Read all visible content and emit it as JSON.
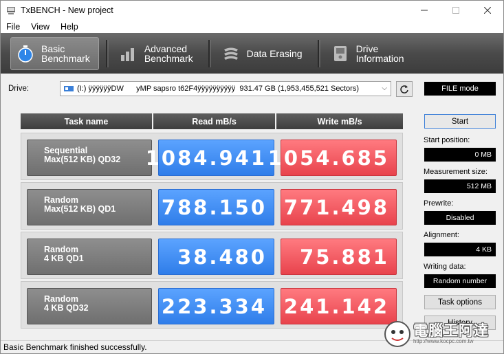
{
  "window": {
    "title": "TxBENCH - New project"
  },
  "menu": {
    "items": [
      "File",
      "View",
      "Help"
    ]
  },
  "toolbar": {
    "tabs": [
      {
        "label": "Basic\nBenchmark",
        "icon": "stopwatch-icon",
        "active": true
      },
      {
        "label": "Advanced\nBenchmark",
        "icon": "bar-chart-icon",
        "active": false
      },
      {
        "label": "Data Erasing",
        "icon": "eraser-icon",
        "active": false
      },
      {
        "label": "Drive\nInformation",
        "icon": "drive-info-icon",
        "active": false
      }
    ]
  },
  "drive": {
    "label": "Drive:",
    "selected": "(I:) ÿÿÿÿÿÿDW      yMP sapsro t62F4ÿÿÿÿÿÿÿÿÿÿ  931.47 GB (1,953,455,521 Sectors)",
    "mode": "FILE mode"
  },
  "table": {
    "headers": [
      "Task name",
      "Read mB/s",
      "Write mB/s"
    ],
    "rows": [
      {
        "task_line1": "Sequential",
        "task_line2": "Max(512 KB) QD32",
        "read": "1084.941",
        "write": "1054.685"
      },
      {
        "task_line1": "Random",
        "task_line2": "Max(512 KB) QD1",
        "read": "788.150",
        "write": "771.498"
      },
      {
        "task_line1": "Random",
        "task_line2": "4 KB QD1",
        "read": "38.480",
        "write": "75.881"
      },
      {
        "task_line1": "Random",
        "task_line2": "4 KB QD32",
        "read": "223.334",
        "write": "241.142"
      }
    ]
  },
  "panel": {
    "start_label": "Start",
    "start_position_label": "Start position:",
    "start_position_value": "0 MB",
    "measurement_size_label": "Measurement size:",
    "measurement_size_value": "512 MB",
    "prewrite_label": "Prewrite:",
    "prewrite_value": "Disabled",
    "alignment_label": "Alignment:",
    "alignment_value": "4 KB",
    "writing_data_label": "Writing data:",
    "writing_data_value": "Random number",
    "task_options_label": "Task options",
    "history_label": "History"
  },
  "status": {
    "text": "Basic Benchmark finished successfully."
  },
  "watermark": {
    "title": "電腦王阿達",
    "url": "http://www.kocpc.com.tw"
  },
  "colors": {
    "read": "#2f7de9",
    "write": "#e8434c",
    "toolbar": "#4a4a4a"
  }
}
